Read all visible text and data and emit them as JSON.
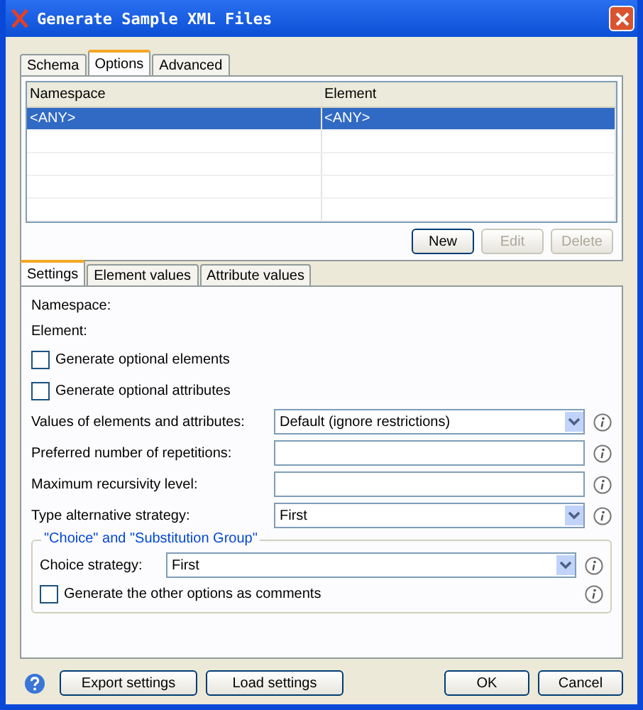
{
  "window": {
    "title": "Generate Sample XML Files"
  },
  "top_tabs": [
    {
      "label": "Schema",
      "selected": false
    },
    {
      "label": "Options",
      "selected": true
    },
    {
      "label": "Advanced",
      "selected": false
    }
  ],
  "table": {
    "columns": [
      "Namespace",
      "Element"
    ],
    "rows": [
      {
        "cells": [
          "<ANY>",
          "<ANY>"
        ],
        "selected": true
      }
    ]
  },
  "table_buttons": [
    {
      "label": "New",
      "disabled": false
    },
    {
      "label": "Edit",
      "disabled": true
    },
    {
      "label": "Delete",
      "disabled": true
    }
  ],
  "settings_tabs": [
    {
      "label": "Settings",
      "selected": true
    },
    {
      "label": "Element values",
      "selected": false
    },
    {
      "label": "Attribute values",
      "selected": false
    }
  ],
  "settings": {
    "labels": [
      "Namespace:",
      "Element:"
    ],
    "checkboxes": [
      {
        "label": "Generate optional elements",
        "checked": false
      },
      {
        "label": "Generate optional attributes",
        "checked": false
      }
    ],
    "fields": [
      {
        "label": "Values of elements and attributes:",
        "kind": "select",
        "value": "Default (ignore restrictions)"
      },
      {
        "label": "Preferred number of repetitions:",
        "kind": "text"
      },
      {
        "label": "Maximum recursivity level:",
        "kind": "text"
      },
      {
        "label": "Type alternative strategy:",
        "kind": "select",
        "value": "First"
      }
    ],
    "group": {
      "title": "\"Choice\" and \"Substitution Group\"",
      "field": {
        "label": "Choice strategy:",
        "kind": "select",
        "value": "First"
      },
      "checkbox": {
        "label": "Generate the other options as comments",
        "checked": false
      }
    }
  },
  "footer": {
    "left_buttons": [
      "Export settings",
      "Load settings"
    ],
    "right_buttons": [
      "OK",
      "Cancel"
    ]
  }
}
